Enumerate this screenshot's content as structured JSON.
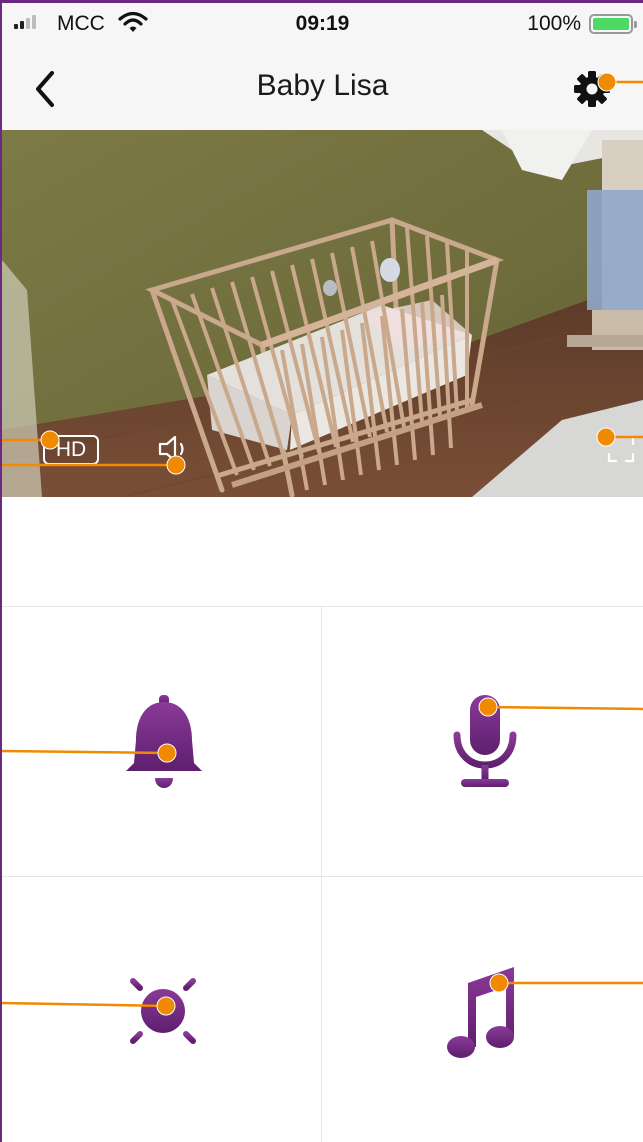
{
  "status_bar": {
    "carrier": "MCC",
    "time": "09:19",
    "battery_percent": "100%",
    "battery_level": 1.0,
    "signal_bars_active": 2,
    "signal_bars_total": 4
  },
  "nav": {
    "title": "Baby Lisa",
    "back_icon": "chevron-left-icon",
    "settings_icon": "gear-icon"
  },
  "video": {
    "hd_label": "HD",
    "speaker_icon": "speaker-icon",
    "fullscreen_icon": "fullscreen-icon"
  },
  "controls": [
    {
      "icon": "bell-icon"
    },
    {
      "icon": "microphone-icon"
    },
    {
      "icon": "sun-icon"
    },
    {
      "icon": "music-note-icon"
    }
  ],
  "colors": {
    "accent_purple_top": "#8a3a98",
    "accent_purple_bottom": "#5e1f6e",
    "annotation_orange": "#f08a00",
    "bar_background": "#f6f6f6",
    "battery_green": "#4cd964"
  }
}
